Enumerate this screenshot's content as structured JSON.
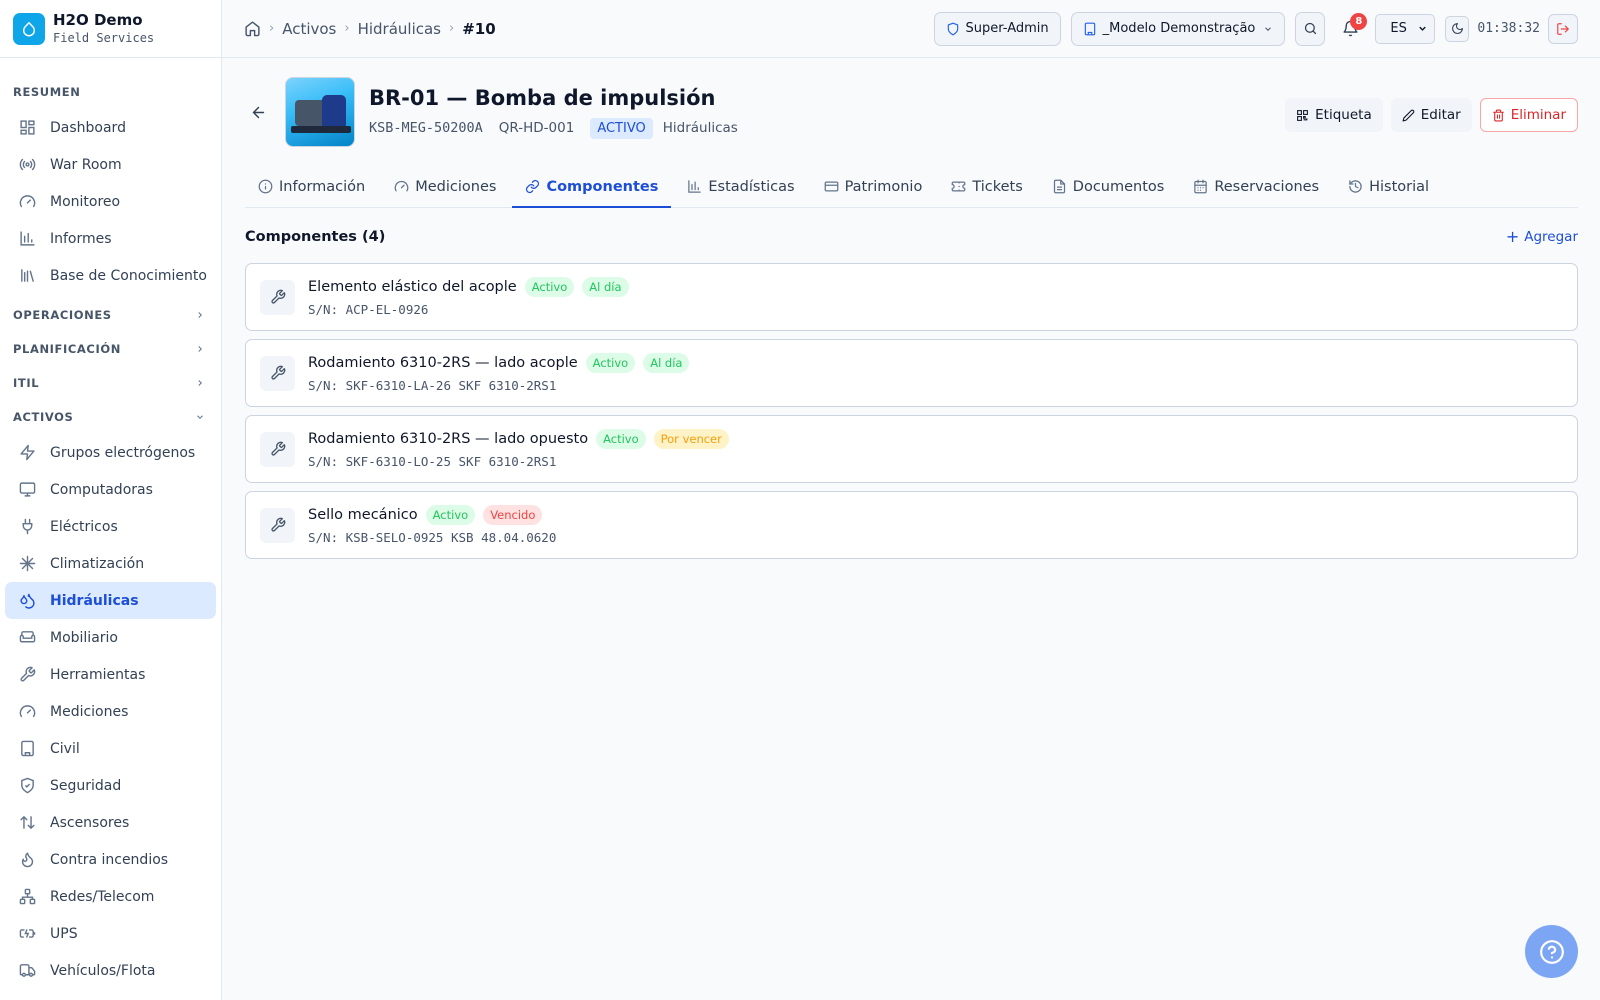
{
  "brand": {
    "name": "H2O Demo",
    "subtitle": "Field Services"
  },
  "sidebar": {
    "resumen": {
      "label": "RESUMEN",
      "items": [
        {
          "label": "Dashboard",
          "icon": "dashboard-icon"
        },
        {
          "label": "War Room",
          "icon": "broadcast-icon"
        },
        {
          "label": "Monitoreo",
          "icon": "gauge-icon"
        },
        {
          "label": "Informes",
          "icon": "bar-chart-icon"
        },
        {
          "label": "Base de Conocimiento",
          "icon": "library-icon"
        }
      ]
    },
    "operaciones": "OPERACIONES",
    "planificacion": "PLANIFICACIÓN",
    "itil": "ITIL",
    "activos": {
      "label": "ACTIVOS",
      "items": [
        {
          "label": "Grupos electrógenos",
          "icon": "zap-icon"
        },
        {
          "label": "Computadoras",
          "icon": "monitor-icon"
        },
        {
          "label": "Eléctricos",
          "icon": "plug-icon"
        },
        {
          "label": "Climatización",
          "icon": "snowflake-icon"
        },
        {
          "label": "Hidráulicas",
          "icon": "droplets-icon",
          "active": true
        },
        {
          "label": "Mobiliario",
          "icon": "sofa-icon"
        },
        {
          "label": "Herramientas",
          "icon": "wrench-icon"
        },
        {
          "label": "Mediciones",
          "icon": "gauge-icon"
        },
        {
          "label": "Civil",
          "icon": "building-icon"
        },
        {
          "label": "Seguridad",
          "icon": "shield-check-icon"
        },
        {
          "label": "Ascensores",
          "icon": "arrows-up-down-icon"
        },
        {
          "label": "Contra incendios",
          "icon": "flame-icon"
        },
        {
          "label": "Redes/Telecom",
          "icon": "network-icon"
        },
        {
          "label": "UPS",
          "icon": "battery-icon"
        },
        {
          "label": "Vehículos/Flota",
          "icon": "truck-icon"
        }
      ]
    }
  },
  "header": {
    "breadcrumbs": [
      "Activos",
      "Hidráulicas",
      "#10"
    ],
    "role": "Super-Admin",
    "org": "_Modelo Demonstração",
    "notifications_count": "8",
    "language": "ES",
    "clock": "01:38:32"
  },
  "asset": {
    "title": "BR-01 — Bomba de impulsión",
    "code": "KSB-MEG-50200A",
    "qr": "QR-HD-001",
    "status": "ACTIVO",
    "category": "Hidráulicas",
    "actions": {
      "label": "Etiqueta",
      "edit": "Editar",
      "delete": "Eliminar"
    }
  },
  "tabs": [
    {
      "label": "Información",
      "icon": "info-icon"
    },
    {
      "label": "Mediciones",
      "icon": "gauge-icon"
    },
    {
      "label": "Componentes",
      "icon": "link-icon",
      "active": true
    },
    {
      "label": "Estadísticas",
      "icon": "bar-chart-icon"
    },
    {
      "label": "Patrimonio",
      "icon": "credit-card-icon"
    },
    {
      "label": "Tickets",
      "icon": "ticket-icon"
    },
    {
      "label": "Documentos",
      "icon": "file-icon"
    },
    {
      "label": "Reservaciones",
      "icon": "calendar-icon"
    },
    {
      "label": "Historial",
      "icon": "history-icon"
    }
  ],
  "components": {
    "title": "Componentes (4)",
    "add_label": "Agregar",
    "items": [
      {
        "name": "Elemento elástico del acople",
        "status": "Activo",
        "due": "Al día",
        "due_color": "#22c55e",
        "sn": "S/N: ACP-EL-0926"
      },
      {
        "name": "Rodamiento 6310-2RS — lado acople",
        "status": "Activo",
        "due": "Al día",
        "due_color": "#22c55e",
        "sn": "S/N: SKF-6310-LA-26 SKF 6310-2RS1"
      },
      {
        "name": "Rodamiento 6310-2RS — lado opuesto",
        "status": "Activo",
        "due": "Por vencer",
        "due_color": "#f59e0b",
        "sn": "S/N: SKF-6310-LO-25 SKF 6310-2RS1"
      },
      {
        "name": "Sello mecánico",
        "status": "Activo",
        "due": "Vencido",
        "due_color": "#ef4444",
        "sn": "S/N: KSB-SELO-0925 KSB 48.04.0620"
      }
    ]
  },
  "colors": {
    "accent": "#1d4ed8",
    "active_bg": "#dbeafe",
    "danger": "#dc2626"
  }
}
